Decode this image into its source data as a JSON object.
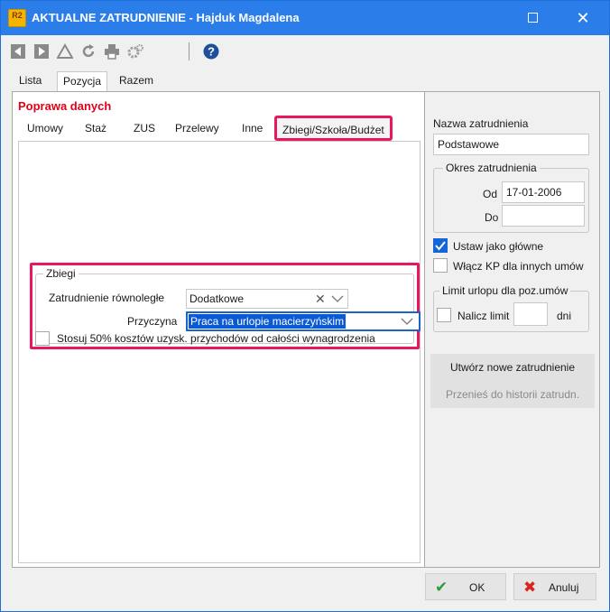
{
  "window": {
    "app_icon": "R2",
    "title": "AKTUALNE ZATRUDNIENIE - Hajduk Magdalena",
    "maximize_icon": "maximize-icon",
    "close_icon": "close-icon",
    "close_glyph": "✕"
  },
  "toolbar": {
    "icons": [
      "first-record-icon",
      "next-record-icon",
      "alert-triangle-icon",
      "refresh-icon",
      "print-icon",
      "settings-icon",
      "help-icon"
    ]
  },
  "page_tabs": [
    {
      "label": "Lista",
      "active": false
    },
    {
      "label": "Pozycja",
      "active": true
    },
    {
      "label": "Razem",
      "active": false
    }
  ],
  "main": {
    "section_title": "Poprawa danych",
    "section_title_color": "#e2001a",
    "highlight_color": "#e8185c",
    "subtabs": [
      {
        "label": "Umowy"
      },
      {
        "label": "Staż"
      },
      {
        "label": "ZUS"
      },
      {
        "label": "Przelewy"
      },
      {
        "label": "Inne"
      },
      {
        "label": "Zbiegi/Szkoła/Budżet",
        "active": true
      }
    ],
    "zbiegi": {
      "legend": "Zbiegi",
      "parallel_label": "Zatrudnienie równoległe",
      "parallel_value": "Dodatkowe",
      "clear_glyph": "✕",
      "reason_label": "Przyczyna",
      "reason_value": "Praca na urlopie macierzyńskim"
    },
    "cost_checkbox": {
      "label": "Stosuj 50% kosztów uzysk. przychodów od całości wynagrodzenia",
      "checked": false
    }
  },
  "right": {
    "name_label": "Nazwa zatrudnienia",
    "name_value": "Podstawowe",
    "period": {
      "legend": "Okres zatrudnienia",
      "from_label": "Od",
      "from_value": "17-01-2006",
      "to_label": "Do",
      "to_value": ""
    },
    "set_main": {
      "label": "Ustaw jako główne",
      "checked": true
    },
    "enable_kp": {
      "label": "Włącz KP dla innych umów",
      "checked": false
    },
    "leave_limit": {
      "legend": "Limit urlopu dla poz.umów",
      "charge_label": "Nalicz limit",
      "checked": false,
      "days_value": "",
      "unit": "dni"
    },
    "create_button": "Utwórz nowe zatrudnienie",
    "history_button": "Przenieś do historii zatrudn."
  },
  "footer": {
    "ok_label": "OK",
    "ok_glyph": "✔",
    "ok_color": "#2e9c3a",
    "cancel_label": "Anuluj",
    "cancel_glyph": "✖",
    "cancel_color": "#d9261c"
  }
}
